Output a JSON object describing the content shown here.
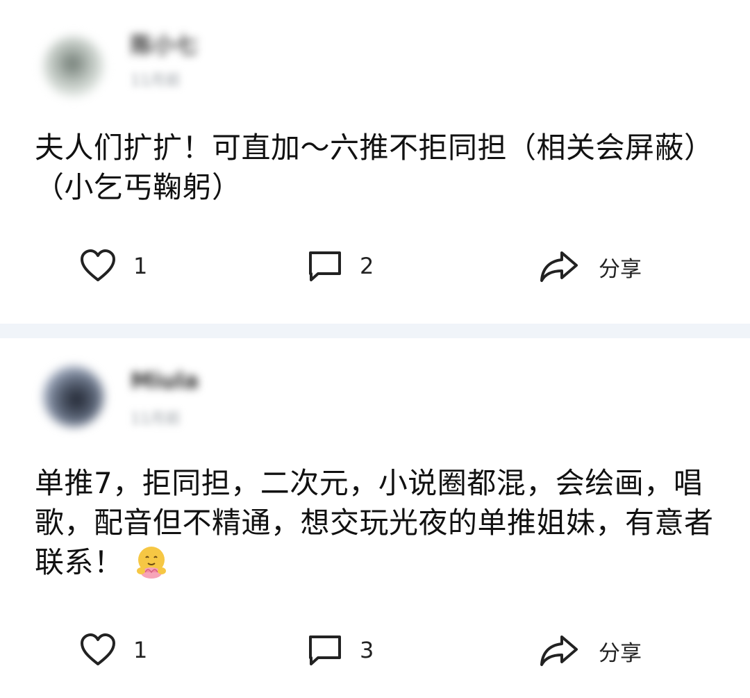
{
  "posts": [
    {
      "user_name": "陈小七",
      "time": "11月前",
      "content": "夫人们扩扩！可直加～六推不拒同担（相关会屏蔽）（小乞丐鞠躬）",
      "likes": "1",
      "comments": "2",
      "share_label": "分享"
    },
    {
      "user_name": "Miula",
      "time": "11月前",
      "content": "单推7，拒同担，二次元，小说圈都混，会绘画，唱歌，配音但不精通，想交玩光夜的单推姐妹，有意者联系！",
      "likes": "1",
      "comments": "3",
      "share_label": "分享"
    }
  ],
  "colors": {
    "background": "#ffffff",
    "divider": "#f0f4f9",
    "text": "#111111",
    "icon": "#222222"
  },
  "icons": {
    "like": "heart-outline-icon",
    "comment": "comment-bubble-icon",
    "share": "share-arrow-icon",
    "emoji": "hugging-face-with-flower-emoji"
  }
}
